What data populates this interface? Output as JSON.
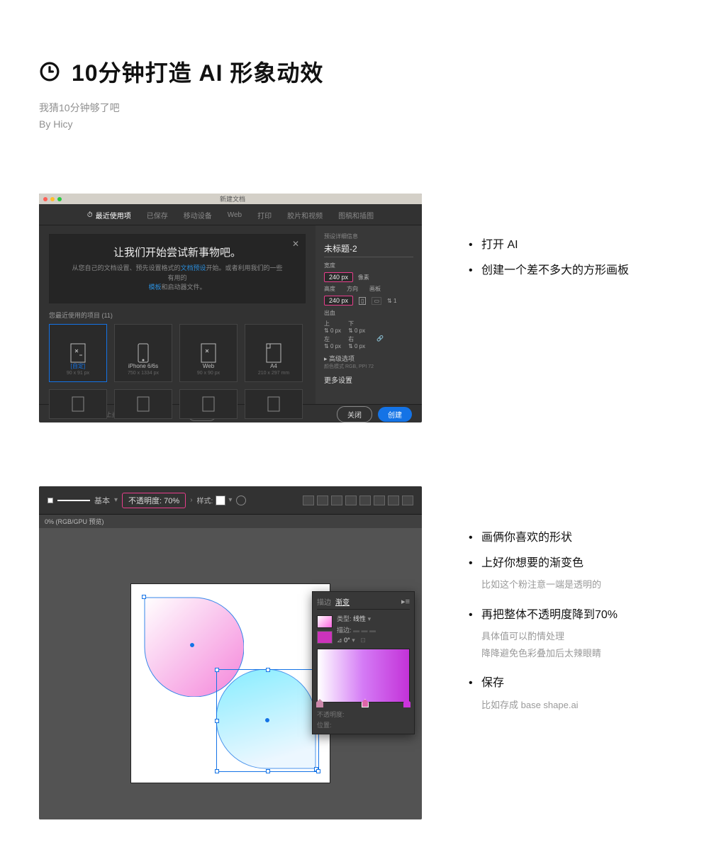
{
  "header": {
    "title": "10分钟打造 AI 形象动效",
    "subtitle": "我猜10分钟够了吧",
    "byline": "By Hicy"
  },
  "section1": {
    "bullets": [
      "打开 AI",
      "创建一个差不多大的方形画板"
    ],
    "dialog": {
      "window_title": "新建文档",
      "tabs": [
        "最近使用项",
        "已保存",
        "移动设备",
        "Web",
        "打印",
        "胶片和视频",
        "图稿和插图"
      ],
      "banner_title": "让我们开始尝试新事物吧。",
      "banner_text_prefix": "从您自己的文档设置、预先设置格式的",
      "banner_link1": "文档预设",
      "banner_text_mid": "开始。或者利用我们的一些有用的",
      "banner_link2": "模板",
      "banner_text_suffix": "和启动器文件。",
      "recent_label": "您最近使用的项目 (11)",
      "presets": [
        {
          "name": "[自定]",
          "dims": "90 x 91 px"
        },
        {
          "name": "iPhone 6/6s",
          "dims": "750 x 1334 px"
        },
        {
          "name": "Web",
          "dims": "90 x 90 px"
        },
        {
          "name": "A4",
          "dims": "210 x 297 mm"
        }
      ],
      "right_panel": {
        "hdr": "预设详细信息",
        "doc_title": "未标题-2",
        "width_label": "宽度",
        "width_val": "240 px",
        "unit": "像素",
        "height_label": "高度",
        "height_val": "240 px",
        "orient_label": "方向",
        "artboard_label": "画板",
        "artboard_count": "1",
        "bleed_label": "出血",
        "bleed_top": "上",
        "bleed_bottom": "下",
        "bleed_left": "左",
        "bleed_right": "右",
        "bleed_val": "0 px",
        "adv": "▸ 高级选项",
        "adv_sub": "颜色模式 RGB, PPI 72",
        "more": "更多设置"
      },
      "search_placeholder": "在 Adobe Stock 上查找更多模板",
      "go_btn": "前往",
      "close_btn": "关闭",
      "create_btn": "创建"
    }
  },
  "section2": {
    "bullets": [
      {
        "text": "画俩你喜欢的形状"
      },
      {
        "text": "上好你想要的渐变色",
        "sub": "比如这个粉注意一端是透明的"
      },
      {
        "text": "再把整体不透明度降到70%",
        "sub": "具体值可以酌情处理\n降降避免色彩叠加后太辣眼睛"
      },
      {
        "text": "保存",
        "sub": "比如存成 base shape.ai"
      }
    ],
    "toolbar": {
      "basic": "基本",
      "opacity_label": "不透明度:",
      "opacity_val": "70%",
      "style_label": "样式:"
    },
    "doc_tab": "0% (RGB/GPU 预览)",
    "gradient_panel": {
      "tab_stroke": "描边",
      "tab_grad": "渐变",
      "type_label": "类型:",
      "type_val": "线性",
      "stroke_label": "描边:",
      "angle_label": "⊿",
      "angle_val": "0°",
      "opacity_label": "不透明度:",
      "position_label": "位置:"
    }
  }
}
